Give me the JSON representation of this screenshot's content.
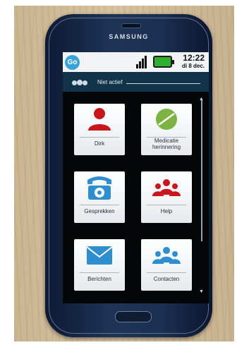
{
  "device": {
    "brand": "SAMSUNG"
  },
  "statusbar": {
    "app_logo": "Go",
    "time": "12:22",
    "date": "di 8 dec.",
    "signal_icon": "signal-icon",
    "battery_icon": "battery-icon",
    "battery_color": "#2fb02f"
  },
  "status": {
    "label": "Niet actief",
    "icon": "people-status-icon"
  },
  "tiles": [
    {
      "label": "Dirk",
      "icon": "person-icon",
      "color": "#c8161d"
    },
    {
      "label": "Medicatie herinnering",
      "icon": "pill-icon",
      "color": "#7cb342"
    },
    {
      "label": "Gesprekken",
      "icon": "phone-icon",
      "color": "#2e8fd0"
    },
    {
      "label": "Help",
      "icon": "help-group-icon",
      "color": "#c8161d"
    },
    {
      "label": "Berichten",
      "icon": "envelope-icon",
      "color": "#2e8fd0"
    },
    {
      "label": "Contacten",
      "icon": "contacts-icon",
      "color": "#2e8fd0"
    }
  ]
}
